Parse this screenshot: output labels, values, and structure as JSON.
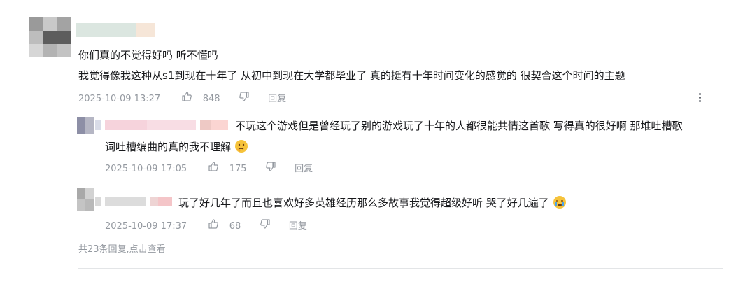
{
  "comment": {
    "line1": "你们真的不觉得好吗 听不懂吗",
    "line2": "我觉得像我这种从s1到现在十年了 从初中到现在大学都毕业了 真的挺有十年时间变化的感觉的 很契合这个时间的主题",
    "time": "2025-10-09 13:27",
    "likes": "848",
    "reply_label": "回复"
  },
  "replies": [
    {
      "text_line1": "不玩这个游戏但是曾经玩了别的游戏玩了十年的人都很能共情这首歌 写得真的很好啊 那堆吐槽歌",
      "text_line2": "词吐槽编曲的真的我不理解",
      "emoji": "thinking-face-icon",
      "time": "2025-10-09 17:05",
      "likes": "175",
      "reply_label": "回复"
    },
    {
      "text_line1": "玩了好几年了而且也喜欢好多英雄经历那么多故事我觉得超级好听 哭了好几遍了",
      "emoji": "crying-face-icon",
      "time": "2025-10-09 17:37",
      "likes": "68",
      "reply_label": "回复"
    }
  ],
  "footer": {
    "summary": "共23条回复,点击查看"
  },
  "colors": {
    "text": "#18191c",
    "meta": "#9499a0",
    "divider": "#e3e5e7"
  }
}
